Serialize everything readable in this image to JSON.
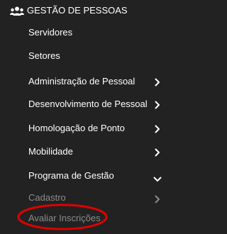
{
  "section": {
    "title": "GESTÃO DE PESSOAS",
    "icon": "users-icon"
  },
  "menu": {
    "items": [
      {
        "label": "Servidores"
      },
      {
        "label": "Setores"
      },
      {
        "label": "Administração de Pessoal"
      },
      {
        "label": "Desenvolvimento de Pessoal"
      },
      {
        "label": "Homologação de Ponto"
      },
      {
        "label": "Mobilidade"
      },
      {
        "label": "Programa de Gestão"
      }
    ]
  },
  "submenu": {
    "items": [
      {
        "label": "Cadastro"
      },
      {
        "label": "Avaliar Inscrições"
      }
    ]
  },
  "colors": {
    "background": "#222222",
    "text": "#ffffff",
    "muted_text": "#8b8b8b",
    "annotation": "#e00000"
  }
}
